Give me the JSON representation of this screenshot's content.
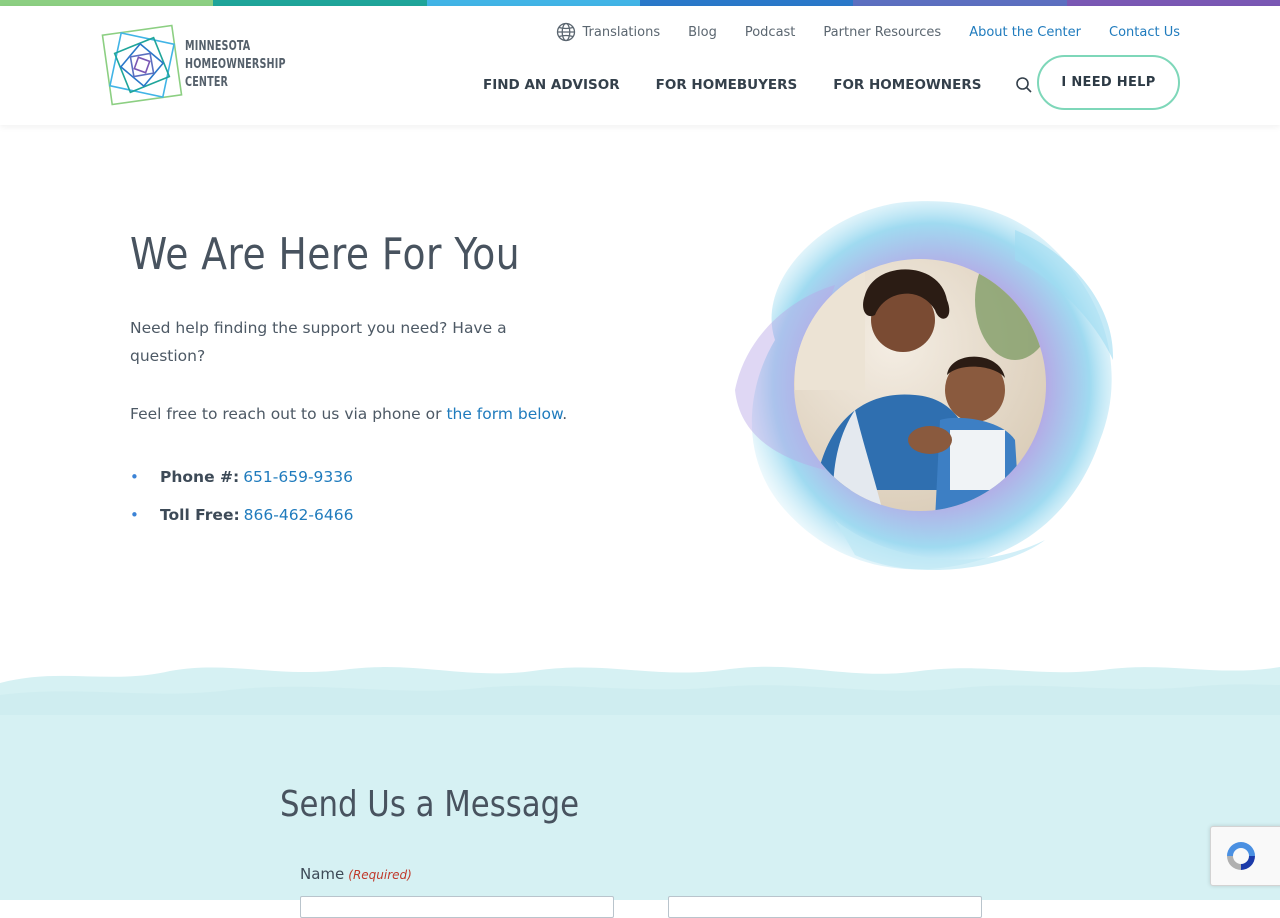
{
  "colors": {
    "topbar": [
      "#8ccf82",
      "#1fa59a",
      "#41b4e6",
      "#2a78c9",
      "#5c6fc0",
      "#7a58b4"
    ],
    "accent_link": "#1f7bbd",
    "help_button_border": "#7ed7b9",
    "wave_background": "#d6f1f3",
    "required": "#c0392b"
  },
  "brand": {
    "logo_alt": "Minnesota Homeownership Center logo",
    "line1": "MINNESOTA",
    "line2": "HOMEOWNERSHIP",
    "line3": "CENTER"
  },
  "utility_nav": {
    "translations": "Translations",
    "blog": "Blog",
    "podcast": "Podcast",
    "partner": "Partner Resources",
    "about": "About the Center",
    "contact": "Contact Us"
  },
  "main_nav": {
    "advisor": "FIND AN ADVISOR",
    "homebuyers": "FOR HOMEBUYERS",
    "homeowners": "FOR HOMEOWNERS",
    "help": "I NEED HELP"
  },
  "hero": {
    "title": "We Are Here For You",
    "para1": "Need help finding the support you need? Have a question?",
    "para2_pre": "Feel free to reach out to us via phone or ",
    "para2_link": "the form below",
    "para2_post": ".",
    "phone_label": "Phone #:",
    "phone_value": "651-659-9336",
    "tollfree_label": "Toll Free:",
    "tollfree_value": "866-462-6466",
    "bullet": "•"
  },
  "form": {
    "title": "Send Us a Message",
    "name_label": "Name",
    "required_note": "(Required)"
  }
}
